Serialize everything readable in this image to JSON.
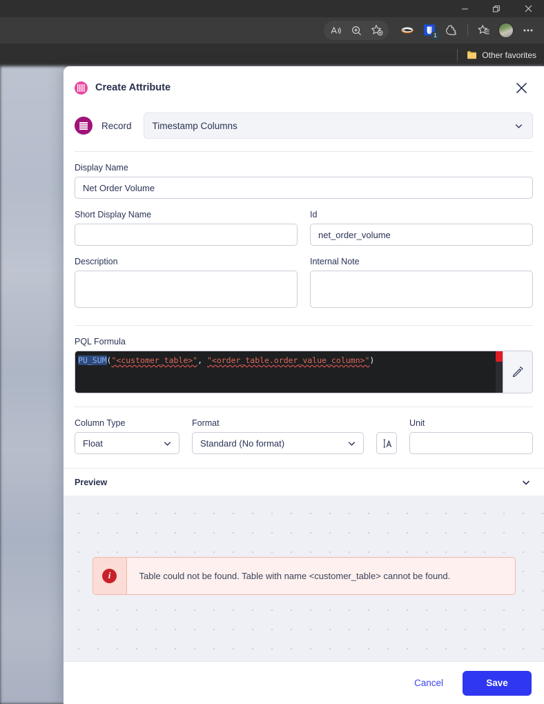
{
  "browser": {
    "window_controls": [
      {
        "name": "minimize-button",
        "icon": "minimize-icon"
      },
      {
        "name": "restore-button",
        "icon": "restore-icon"
      },
      {
        "name": "close-button",
        "icon": "close-icon"
      }
    ],
    "toolbar_icons": [
      {
        "name": "read-aloud-icon",
        "label": "Read aloud"
      },
      {
        "name": "zoom-icon",
        "label": "Zoom"
      },
      {
        "name": "add-favorite-icon",
        "label": "Add this page to favorites"
      },
      {
        "name": "extension-badger-icon",
        "label": "Extension"
      },
      {
        "name": "extension-blue-icon",
        "label": "Extension",
        "badge": "1"
      },
      {
        "name": "browser-essentials-icon",
        "label": "Browser essentials"
      },
      {
        "name": "favorites-icon",
        "label": "Favorites"
      },
      {
        "name": "profile-avatar",
        "label": "Profile"
      },
      {
        "name": "settings-and-more-icon",
        "label": "Settings and more"
      }
    ],
    "favorites_bar": {
      "folder_label": "Other favorites"
    }
  },
  "dialog": {
    "title": "Create Attribute",
    "close_label": "Close",
    "record": {
      "label": "Record",
      "value": "Timestamp Columns"
    },
    "fields": {
      "display_name": {
        "label": "Display Name",
        "value": "Net Order Volume",
        "placeholder": ""
      },
      "short_display_name": {
        "label": "Short Display Name",
        "value": "",
        "placeholder": ""
      },
      "id": {
        "label": "Id",
        "value": "net_order_volume",
        "placeholder": ""
      },
      "description": {
        "label": "Description",
        "value": "",
        "placeholder": ""
      },
      "internal_note": {
        "label": "Internal Note",
        "value": "",
        "placeholder": ""
      },
      "unit": {
        "label": "Unit",
        "value": "",
        "placeholder": ""
      }
    },
    "pql": {
      "label": "PQL Formula",
      "formula": "PU_SUM(\"<customer_table>\", \"<order_table.order_value_column>\")",
      "tokens": {
        "function": "PU_SUM",
        "open_paren": "(",
        "arg1": "\"<customer_table>\"",
        "comma": ", ",
        "arg2": "\"<order_table.order_value_column>\"",
        "close_paren": ")"
      },
      "edit_button_label": "Edit formula"
    },
    "column_type": {
      "label": "Column Type",
      "value": "Float"
    },
    "format": {
      "label": "Format",
      "value": "Standard (No format)",
      "text_format_button": "A"
    },
    "preview": {
      "label": "Preview",
      "error": {
        "icon": "i",
        "message": "Table could not be found. Table with name <customer_table> cannot be found."
      }
    },
    "footer": {
      "cancel_label": "Cancel",
      "save_label": "Save"
    },
    "colors": {
      "accent_blue": "#2f38f0",
      "brand_pink": "#e8479f",
      "record_magenta": "#a0147a",
      "error_red": "#c8202a",
      "error_bg": "#fdf0ee"
    }
  }
}
